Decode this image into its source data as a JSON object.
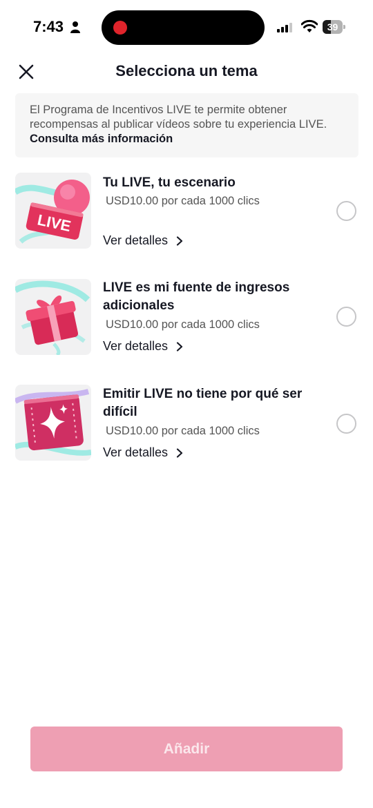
{
  "status_bar": {
    "time": "7:43",
    "battery": "39",
    "icons": [
      "person-icon",
      "signal-icon",
      "wifi-icon",
      "battery-icon"
    ]
  },
  "header": {
    "title": "Selecciona un tema",
    "close_icon": "close-icon"
  },
  "info": {
    "text": "El Programa de Incentivos LIVE te permite obtener recompensas al publicar vídeos sobre tu experiencia LIVE.",
    "link": "Consulta más información"
  },
  "topics": [
    {
      "title": "Tu LIVE, tu escenario",
      "price": "USD10.00 por cada 1000 clics",
      "details": "Ver detalles",
      "thumb_text": "LIVE",
      "thumb_icon": "live-badge-icon",
      "selected": false
    },
    {
      "title": "LIVE es mi fuente de ingresos adicionales",
      "price": "USD10.00 por cada 1000 clics",
      "details": "Ver detalles",
      "thumb_icon": "gift-icon",
      "selected": false
    },
    {
      "title": "Emitir LIVE no tiene por qué ser difícil",
      "price": "USD10.00 por cada 1000 clics",
      "details": "Ver detalles",
      "thumb_icon": "sparkle-film-icon",
      "selected": false
    }
  ],
  "footer": {
    "add_label": "Añadir"
  },
  "colors": {
    "accent_disabled": "#ee9fb3",
    "brand_pink": "#fe2c55",
    "teal": "#7fe6dc"
  }
}
